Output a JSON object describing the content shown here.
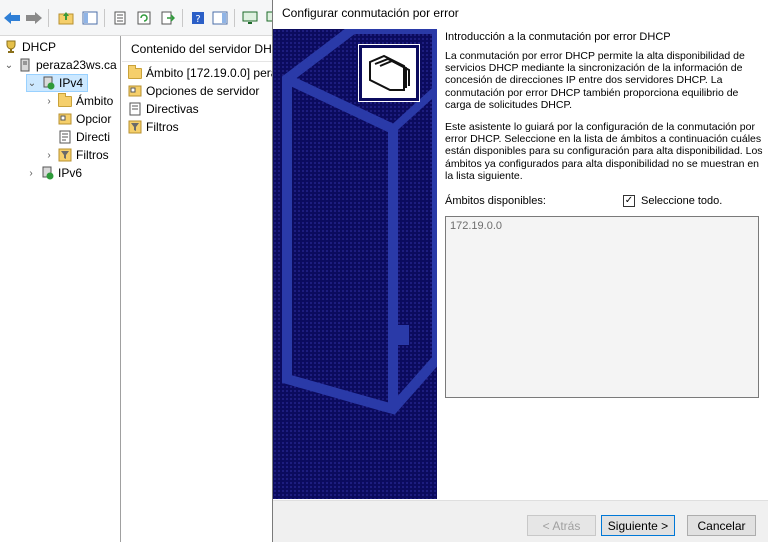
{
  "mmc": {
    "tree": {
      "root": "DHCP",
      "server": "peraza23ws.ca",
      "ipv4": "IPv4",
      "ambitos": "Ámbito",
      "opciones": "Opcior",
      "directivas": "Directi",
      "filtros": "Filtros",
      "ipv6": "IPv6"
    },
    "content": {
      "header": "Contenido del servidor DHC",
      "items": [
        "Ámbito [172.19.0.0] pera",
        "Opciones de servidor",
        "Directivas",
        "Filtros"
      ]
    }
  },
  "wizard": {
    "title": "Configurar conmutación por error",
    "heading": "Introducción a la conmutación por error DHCP",
    "paragraph1": "La conmutación por error DHCP permite la alta disponibilidad de servicios DHCP mediante la sincronización de la información de concesión de direcciones IP entre dos servidores DHCP. La conmutación por error DHCP también proporciona equilibrio de carga de solicitudes DHCP.",
    "paragraph2": "Este asistente lo guiará por la configuración de la conmutación por error DHCP. Seleccione en la lista de ámbitos a continuación cuáles están disponibles para su configuración para alta disponibilidad. Los ámbitos ya configurados para alta disponibilidad no se muestran en la lista siguiente.",
    "available_label": "Ámbitos disponibles:",
    "select_all_label": "Seleccione todo.",
    "select_all_checked": true,
    "check_mark": "✓",
    "scopes": [
      "172.19.0.0"
    ],
    "buttons": {
      "back": "< Atrás",
      "next": "Siguiente >",
      "cancel": "Cancelar"
    }
  }
}
